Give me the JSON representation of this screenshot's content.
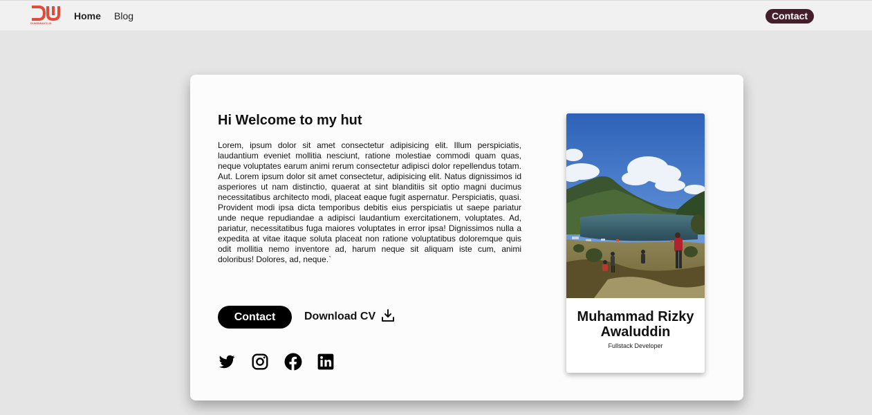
{
  "navbar": {
    "logo_text": "DUMBWAYS.ID",
    "links": [
      "Home",
      "Blog"
    ],
    "contact_label": "Contact"
  },
  "hero": {
    "title": "Hi Welcome to my hut",
    "description": "Lorem, ipsum dolor sit amet consectetur adipisicing elit. Illum perspiciatis, laudantium eveniet mollitia nesciunt, ratione molestiae commodi quam quas, neque voluptates earum animi rerum consectetur adipisci dolor repellendus totam. Aut. Lorem ipsum dolor sit amet consectetur, adipisicing elit. Natus dignissimos id asperiores ut nam distinctio, quaerat at sint blanditiis sit optio magni ducimus necessitatibus architecto modi, placeat eaque fugit aspernatur. Perspiciatis, quasi. Provident modi ipsa dicta temporibus debitis eius perspiciatis ut saepe pariatur unde neque repudiandae a adipisci laudantium exercitationem, voluptates. Ad, pariatur, necessitatibus fuga maiores voluptates in error ipsa! Dignissimos nulla a expedita at vitae itaque soluta placeat non ratione voluptatibus doloremque quis odit mollitia nemo inventore ad, harum neque sit aliquam iste cum, animi doloribus! Dolores, ad, neque.`",
    "contact_button": "Contact",
    "download_cv": "Download CV",
    "socials": [
      "twitter-icon",
      "instagram-icon",
      "facebook-icon",
      "linkedin-icon"
    ]
  },
  "profile": {
    "name": "Muhammad Rizky Awaluddin",
    "role": "Fullstack Developer"
  },
  "colors": {
    "page_bg": "#e5e5e5",
    "navbar_bg": "#f1f1f1",
    "nav_contact_bg": "#451e2b",
    "logo_red": "#e24a3b",
    "card_bg": "#fcfcfc",
    "button_black": "#000000"
  }
}
